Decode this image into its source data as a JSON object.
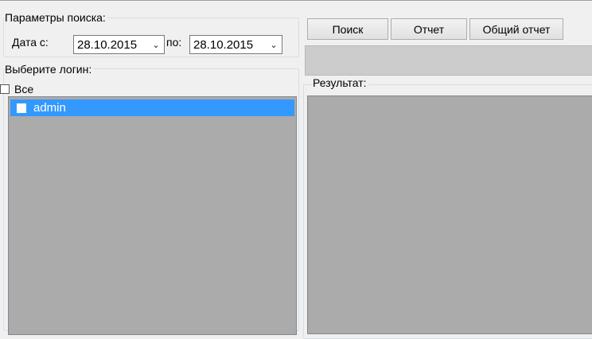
{
  "search_params": {
    "title": "Параметры поиска:",
    "date_from_label": "Дата с:",
    "date_from_value": "28.10.2015",
    "date_to_label": "по:",
    "date_to_value": "28.10.2015"
  },
  "login_select": {
    "title": "Выберите логин:",
    "all_label": "Все",
    "items": [
      {
        "label": "admin",
        "selected": true
      }
    ]
  },
  "toolbar": {
    "search_label": "Поиск",
    "report_label": "Отчет",
    "general_report_label": "Общий отчет"
  },
  "results": {
    "title": "Результат:"
  },
  "colors": {
    "selection": "#3399ff",
    "panel_bg": "#ababab",
    "window_bg": "#f0f0f0"
  }
}
